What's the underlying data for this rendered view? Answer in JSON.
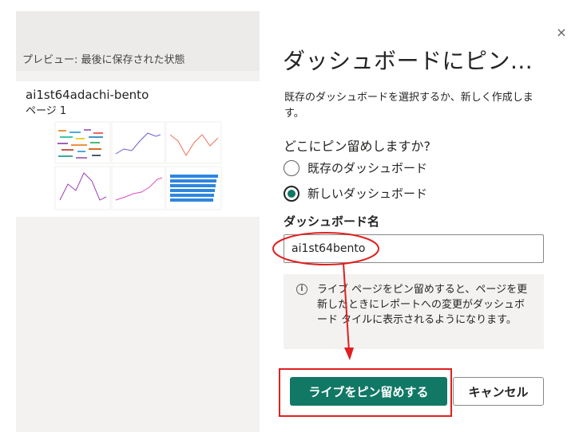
{
  "preview": {
    "title": "プレビュー: 最後に保存された状態",
    "report_name": "ai1st64adachi-bento",
    "page_label": "ページ 1"
  },
  "dialog": {
    "close_glyph": "×",
    "title": "ダッシュボードにピン...",
    "description": "既存のダッシュボードを選択するか、新しく作成します。",
    "question": "どこにピン留めしますか?",
    "options": [
      {
        "label": "既存のダッシュボード",
        "checked": false
      },
      {
        "label": "新しいダッシュボード",
        "checked": true
      }
    ],
    "name_field": {
      "label": "ダッシュボード名",
      "value": "ai1st64bento"
    },
    "info": {
      "icon": "info-icon",
      "text": "ライブ ページをピン留めすると、ページを更新したときにレポートへの変更がダッシュボード タイルに表示されるようになります。"
    },
    "buttons": {
      "primary": "ライブをピン留めする",
      "secondary": "キャンセル"
    }
  },
  "colors": {
    "accent": "#117865",
    "annotation": "#e02020"
  }
}
